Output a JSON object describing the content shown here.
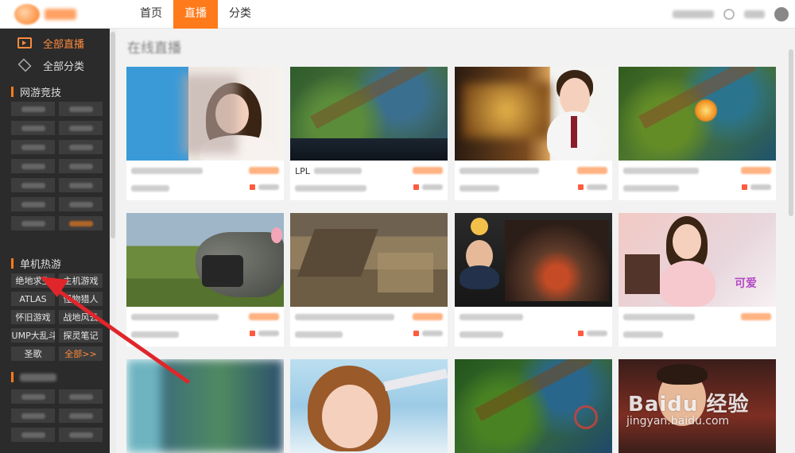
{
  "header": {
    "nav": [
      "首页",
      "直播",
      "分类"
    ],
    "active_nav": "直播"
  },
  "sidebar": {
    "links": [
      {
        "label": "全部直播",
        "icon": "tv-icon",
        "active": true
      },
      {
        "label": "全部分类",
        "icon": "layers-icon",
        "active": false
      }
    ],
    "sections": [
      {
        "title": "网游竞技"
      },
      {
        "title": "单机热游",
        "tags": [
          "绝地求生",
          "主机游戏",
          "ATLAS",
          "怪物猎人",
          "怀旧游戏",
          "战地风云",
          "JUMP大乱斗",
          "探灵笔记",
          "圣歌",
          "全部>>"
        ]
      }
    ]
  },
  "cards": [
    {
      "title": "LPL"
    },
    {
      "title": "",
      "blur": true
    },
    {
      "title": "",
      "blur": true
    },
    {
      "title": "",
      "blur": true
    },
    {
      "title": "",
      "blur": true
    },
    {
      "title": "",
      "blur": true
    },
    {
      "title": "",
      "blur": true
    },
    {
      "title": "",
      "blur": true
    }
  ],
  "watermark": {
    "brand": "Baidu",
    "suffix": "经验",
    "url": "jingyan.baidu.com"
  },
  "colors": {
    "accent": "#ff7a1a",
    "sidebar": "#2b2b2b"
  }
}
